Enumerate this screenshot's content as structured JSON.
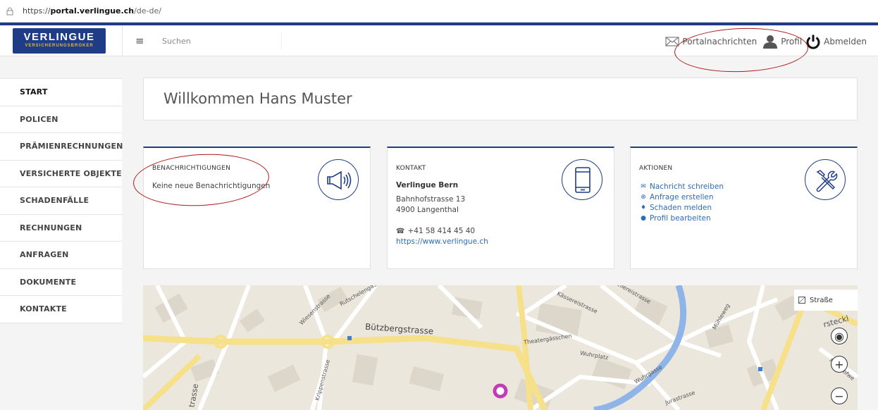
{
  "browser": {
    "url_scheme": "https://",
    "url_host": "portal.verlingue.ch",
    "url_path": "/de-de/"
  },
  "header": {
    "logo_title": "VERLINGUE",
    "logo_subtitle": "VERSICHERUNGSBROKER",
    "search_placeholder": "Suchen",
    "messages_label": "Portalnachrichten",
    "profile_label": "Profil",
    "logout_label": "Abmelden"
  },
  "sidebar": {
    "items": [
      {
        "label": "START"
      },
      {
        "label": "POLICEN"
      },
      {
        "label": "PRÄMIENRECHNUNGEN"
      },
      {
        "label": "VERSICHERTE OBJEKTE"
      },
      {
        "label": "SCHADENFÄLLE"
      },
      {
        "label": "RECHNUNGEN"
      },
      {
        "label": "ANFRAGEN"
      },
      {
        "label": "DOKUMENTE"
      },
      {
        "label": "KONTAKTE"
      }
    ]
  },
  "main": {
    "welcome": "Willkommen Hans Muster",
    "notifications": {
      "title": "BENACHRICHTIGUNGEN",
      "text": "Keine neue Benachrichtigungen",
      "icon": "megaphone-icon"
    },
    "contact": {
      "title": "KONTAKT",
      "name": "Verlingue Bern",
      "street": "Bahnhofstrasse 13",
      "city": "4900 Langenthal",
      "phone": "+41 58 414 45 40",
      "website": "https://www.verlingue.ch",
      "icon": "mobile-phone-icon"
    },
    "actions": {
      "title": "AKTIONEN",
      "items": [
        {
          "label": "Nachricht schreiben",
          "icon": "envelope-icon"
        },
        {
          "label": "Anfrage erstellen",
          "icon": "lifebuoy-icon"
        },
        {
          "label": "Schaden melden",
          "icon": "fire-icon"
        },
        {
          "label": "Profil bearbeiten",
          "icon": "user-icon"
        }
      ],
      "icon": "tools-icon"
    }
  },
  "map": {
    "toggle_label": "Straße",
    "streets": {
      "main": "Bützbergstrasse",
      "wiesen": "Wiesenstrasse",
      "rutschelen": "Rutschelengässch",
      "kaserei": "Kässereistrasse",
      "seilerei": "Seilereistrasse",
      "theater": "Theatergässchen",
      "wuhrplatz": "Wuhrplatz",
      "wuhrgasse": "Wuhrgasse",
      "jura": "Jurastrasse",
      "muehle": "Mühleweg",
      "friedhof": "Friedhofwe",
      "krippen": "Krippenstrasse",
      "trasse": "trasse",
      "steckl": "rsteckl"
    }
  },
  "colors": {
    "brand_blue": "#1f3c86",
    "link_blue": "#2a6cb7",
    "annotation_red": "#b01919"
  }
}
